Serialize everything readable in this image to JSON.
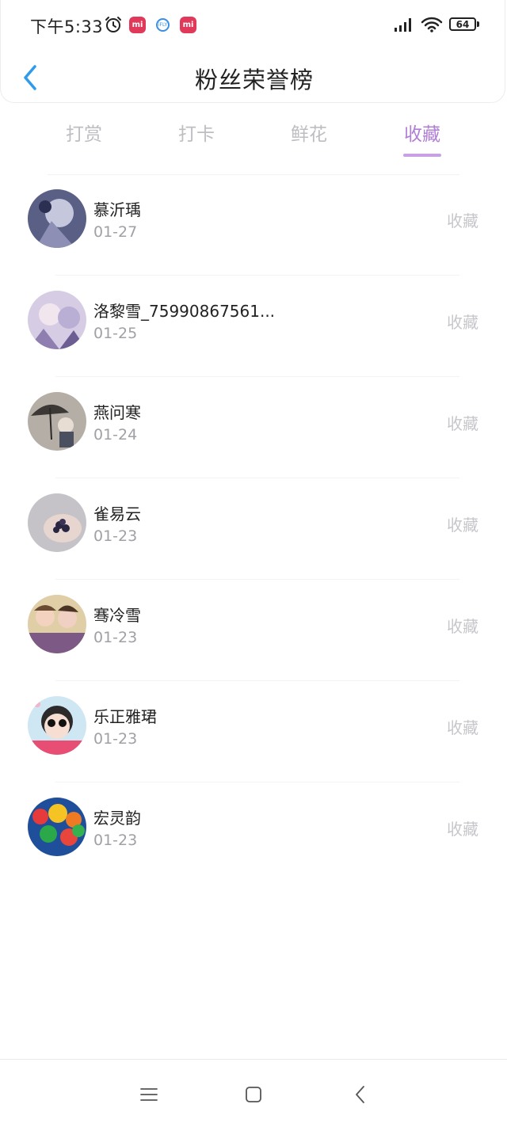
{
  "status_bar": {
    "time": "下午5:33",
    "mi_label": "mi",
    "ifly_label": "iFLY",
    "battery": "64"
  },
  "header": {
    "title": "粉丝荣誉榜"
  },
  "tabs": [
    {
      "label": "打赏"
    },
    {
      "label": "打卡"
    },
    {
      "label": "鲜花"
    },
    {
      "label": "收藏"
    }
  ],
  "active_tab": "收藏",
  "accent_color": "#b17fd6",
  "items": [
    {
      "name": "慕沂瑀",
      "date": "01-27",
      "tag": "收藏"
    },
    {
      "name": "洛黎雪_75990867561...",
      "date": "01-25",
      "tag": "收藏"
    },
    {
      "name": "燕问寒",
      "date": "01-24",
      "tag": "收藏"
    },
    {
      "name": "雀易云",
      "date": "01-23",
      "tag": "收藏"
    },
    {
      "name": "骞冷雪",
      "date": "01-23",
      "tag": "收藏"
    },
    {
      "name": "乐正雅珺",
      "date": "01-23",
      "tag": "收藏"
    },
    {
      "name": "宏灵韵",
      "date": "01-23",
      "tag": "收藏"
    }
  ]
}
